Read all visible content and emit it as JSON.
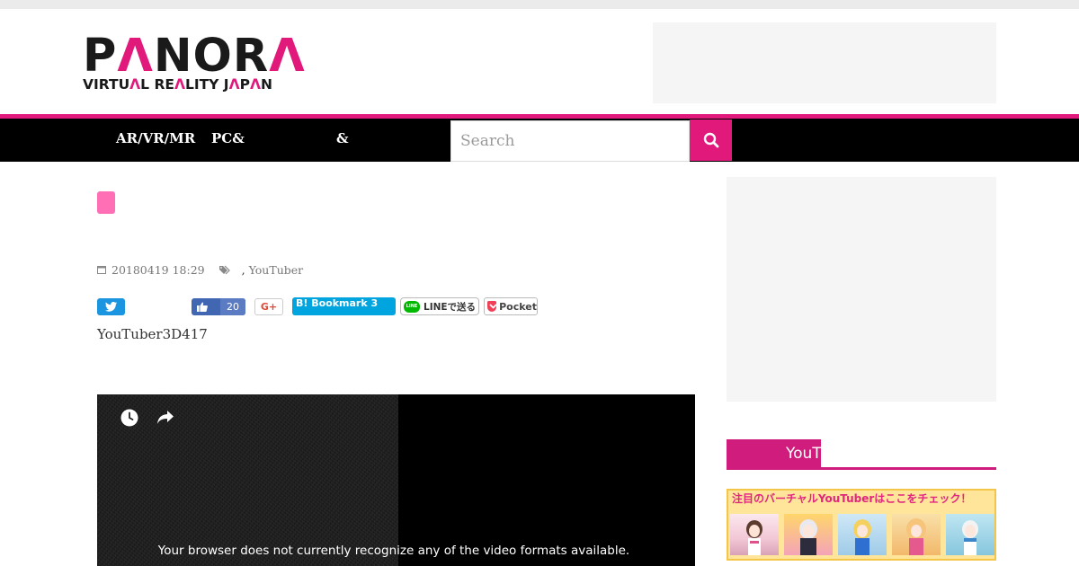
{
  "brand": {
    "logo_part1": "P",
    "logo_part2": "Λ",
    "logo_part3": "NOR",
    "logo_part4": "Λ",
    "tagline_part1": "VIRTU",
    "tagline_part2": "Λ",
    "tagline_part3": "L RE",
    "tagline_part4": "Λ",
    "tagline_part5": "LITY J",
    "tagline_part6": "Λ",
    "tagline_part7": "P",
    "tagline_part8": "Λ",
    "tagline_part9": "N",
    "accent": "#e0197a"
  },
  "nav": {
    "items": [
      {
        "label": "AR/VR/MR"
      },
      {
        "label": "PC&"
      },
      {
        "label": "&"
      }
    ],
    "search_placeholder": "Search"
  },
  "article": {
    "date": "20180419 18:29",
    "tag_separator": ",",
    "tag": "YouTuber",
    "share": {
      "facebook_count": "20",
      "google_label": "G+",
      "hatena_label": "B! Bookmark 3",
      "line_label": "LINEで送る",
      "pocket_label": "Pocket"
    },
    "intro": "YouTuber3D417",
    "video_message": "Your browser does not currently recognize any of the video formats available."
  },
  "sidebar": {
    "heading": "YouT",
    "banner_text": "注目のバーチャルYouTuberはここをチェック！"
  },
  "icons": {
    "search": "search-icon",
    "calendar": "calendar-icon",
    "tags": "tags-icon",
    "twitter": "twitter-bird-icon",
    "facebook_like": "thumbs-up-icon",
    "clock": "clock-icon",
    "share": "share-arrow-icon",
    "pocket": "pocket-icon"
  }
}
